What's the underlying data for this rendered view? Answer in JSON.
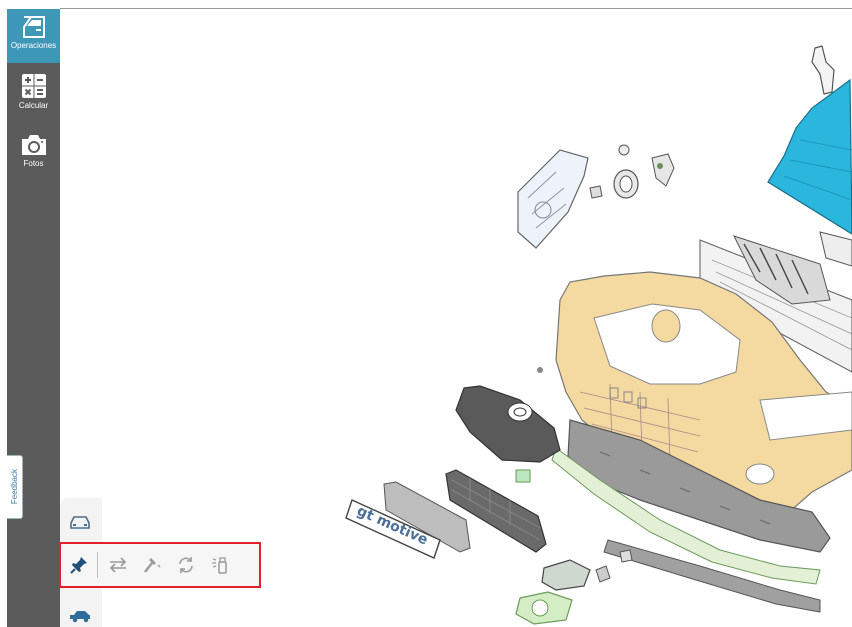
{
  "sidebar": {
    "items": [
      {
        "label": "Operaciones",
        "icon": "car-door-icon",
        "active": true
      },
      {
        "label": "Calcular",
        "icon": "calculator-icon",
        "active": false
      },
      {
        "label": "Fotos",
        "icon": "camera-icon",
        "active": false
      }
    ]
  },
  "feedback": {
    "label": "Feedback"
  },
  "plate": {
    "text": "gt motive"
  },
  "toolbar": {
    "tools": [
      "pin-icon",
      "swap-arrows-icon",
      "hammer-icon",
      "refresh-icon",
      "spray-paint-icon"
    ]
  },
  "colors": {
    "sidebar": "#5b5b5b",
    "active": "#3d97b6",
    "bumper": "#f4d9a0",
    "hood": "#2bb6dd",
    "highlight_border": "#e0202a"
  }
}
